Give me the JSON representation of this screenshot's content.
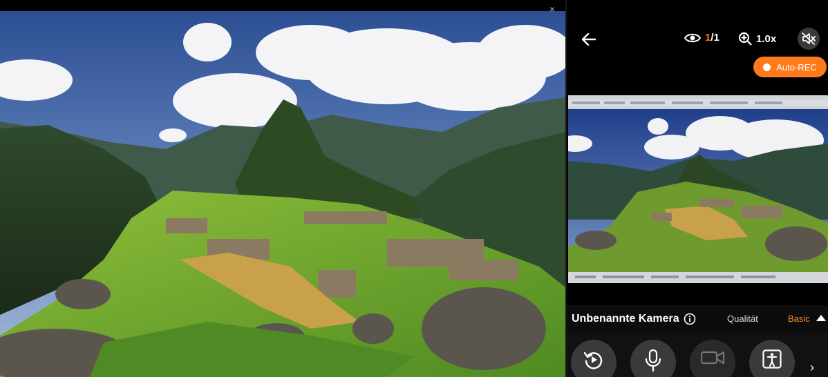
{
  "viewer": {
    "close_glyph": "×"
  },
  "panel": {
    "viewers_current": "1",
    "viewers_total": "/1",
    "zoom": "1.0x",
    "auto_rec_label": "Auto-REC",
    "camera_name": "Unbenannte Kamera",
    "quality_label": "Qualität",
    "quality_value": "Basic",
    "next_glyph": "›"
  },
  "icons": [
    "back-arrow-icon",
    "eye-icon",
    "zoom-in-icon",
    "speaker-muted-icon",
    "record-dot-icon",
    "info-icon",
    "caret-up-icon",
    "replay-icon",
    "microphone-icon",
    "video-camera-icon",
    "person-frame-icon",
    "chevron-right-icon"
  ],
  "colors": {
    "accent": "#ff7a1a",
    "panel_bg": "#000000",
    "button_bg": "#3a3a3a"
  }
}
